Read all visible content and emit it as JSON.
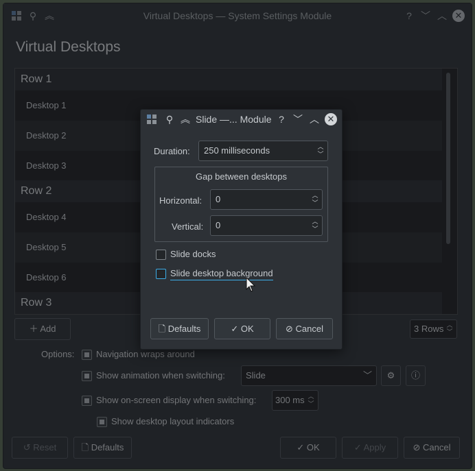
{
  "window": {
    "title": "Virtual Desktops — System Settings Module",
    "help": "?",
    "minimize": "﹀",
    "maximize": "︿",
    "close": "✕"
  },
  "page": {
    "title": "Virtual Desktops"
  },
  "desktops": {
    "rows": [
      {
        "label": "Row 1",
        "desktops": [
          "Desktop 1",
          "Desktop 2",
          "Desktop 3"
        ]
      },
      {
        "label": "Row 2",
        "desktops": [
          "Desktop 4",
          "Desktop 5",
          "Desktop 6"
        ]
      },
      {
        "label": "Row 3",
        "desktops": []
      }
    ]
  },
  "controls": {
    "add_label": "Add",
    "rows_value": "3 Rows"
  },
  "options": {
    "label": "Options:",
    "navigation_wraps": {
      "label": "Navigation wraps around",
      "checked": true
    },
    "show_animation": {
      "label": "Show animation when switching:",
      "checked": true,
      "selected": "Slide"
    },
    "show_osd": {
      "label": "Show on-screen display when switching:",
      "checked": true,
      "duration": "300 ms"
    },
    "show_layout_indicators": {
      "label": "Show desktop layout indicators",
      "checked": true
    }
  },
  "footer": {
    "reset": "Reset",
    "defaults": "Defaults",
    "ok": "OK",
    "apply": "Apply",
    "cancel": "Cancel"
  },
  "dialog": {
    "title": "Slide —... Module",
    "help": "?",
    "duration_label": "Duration:",
    "duration_value": "250 milliseconds",
    "gap_title": "Gap between desktops",
    "horizontal_label": "Horizontal:",
    "horizontal_value": "0",
    "vertical_label": "Vertical:",
    "vertical_value": "0",
    "slide_docks": {
      "label": "Slide docks",
      "checked": false
    },
    "slide_background": {
      "label": "Slide desktop background",
      "checked": false
    },
    "defaults": "Defaults",
    "ok": "OK",
    "cancel": "Cancel"
  }
}
